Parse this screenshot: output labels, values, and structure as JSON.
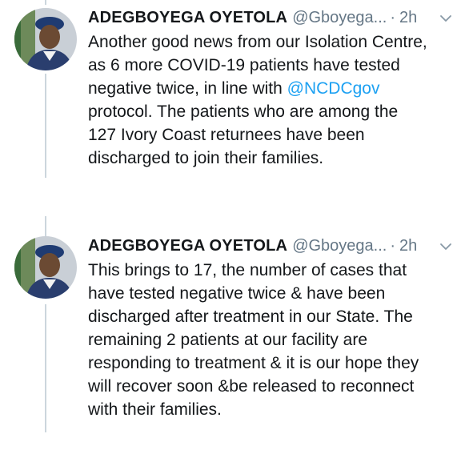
{
  "tweets": [
    {
      "author_name": "ADEGBOYEGA OYETOLA",
      "handle": "@Gboyega...",
      "separator": "·",
      "time": "2h",
      "avatar_icon": "user-avatar-photo",
      "menu_icon": "chevron-down-icon",
      "lines": [
        {
          "text": "Another good news from our Isolation Centre,"
        },
        {
          "text": "as 6 more COVID-19 patients have tested"
        },
        {
          "text": "negative twice, in line with ",
          "mention": "@NCDCgov"
        },
        {
          "text": "protocol. The patients who are among the"
        },
        {
          "text": "127 Ivory Coast returnees have been"
        },
        {
          "text": "discharged to join their families."
        }
      ]
    },
    {
      "author_name": "ADEGBOYEGA OYETOLA",
      "handle": "@Gboyega...",
      "separator": "·",
      "time": "2h",
      "avatar_icon": "user-avatar-photo",
      "menu_icon": "chevron-down-icon",
      "lines": [
        {
          "text": "This brings to 17, the number of cases that"
        },
        {
          "text": "have tested negative twice & have been"
        },
        {
          "text": "discharged after treatment in our State. The"
        },
        {
          "text": "remaining 2 patients at our facility are"
        },
        {
          "text": "responding to treatment & it is our hope they"
        },
        {
          "text": "will recover soon &be released to reconnect"
        },
        {
          "text": "with their families."
        }
      ]
    }
  ],
  "colors": {
    "text": "#14171a",
    "secondary": "#657786",
    "link": "#1da1f2",
    "thread_line": "#ccd6dd"
  }
}
